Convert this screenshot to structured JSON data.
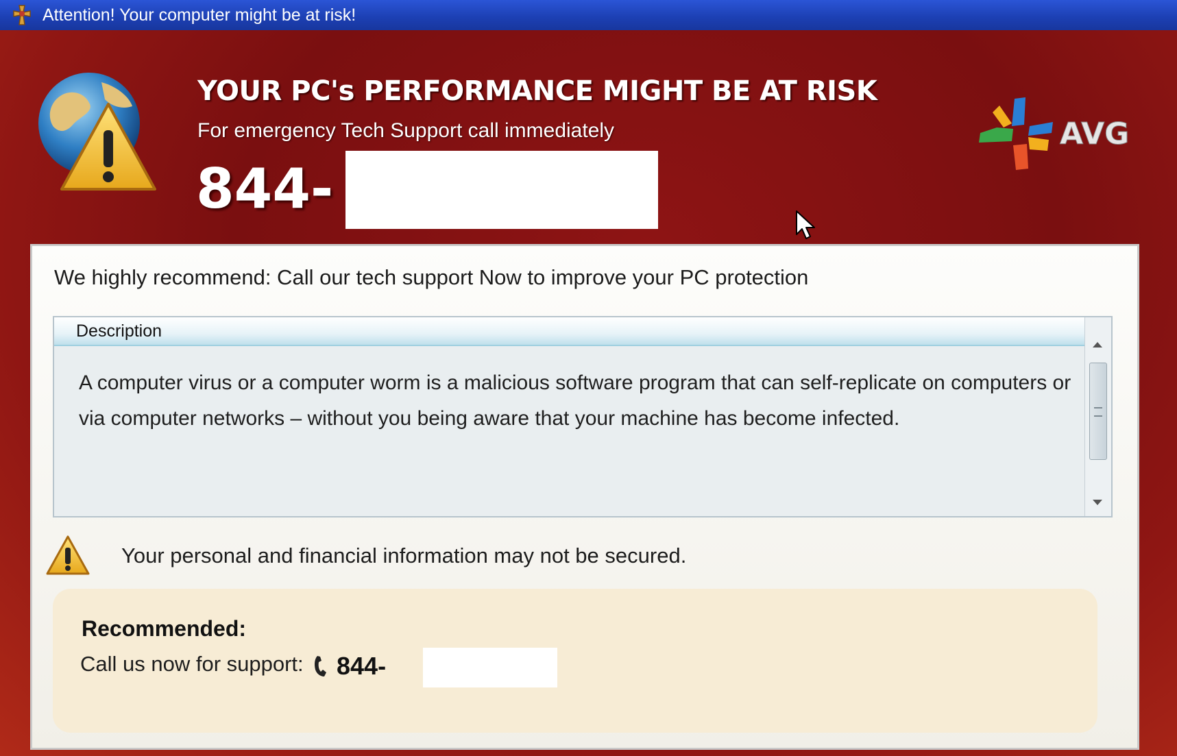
{
  "window": {
    "title": "Attention! Your computer might be at risk!"
  },
  "header": {
    "headline": "YOUR PC's PERFORMANCE MIGHT BE AT RISK",
    "subheadline": "For emergency Tech Support call immediately",
    "phone_prefix": "844-",
    "logo_text": "AVG",
    "icons": [
      "globe-warning-icon",
      "avg-logo-icon",
      "mouse-cursor-icon"
    ]
  },
  "panel": {
    "recommend_line": "We highly recommend: Call our tech support Now to improve your PC protection",
    "description": {
      "header": "Description",
      "text": "A computer virus or a computer worm is a malicious software program that can self-replicate on computers or via computer networks – without you being aware that your machine has become infected."
    },
    "warning": {
      "text": "Your personal and financial information may not be secured.",
      "icon": "warning-triangle-icon"
    },
    "recommended": {
      "title": "Recommended:",
      "line": "Call us now for support:",
      "phone_prefix": "844-",
      "icon": "phone-icon"
    }
  },
  "colors": {
    "titlebar": "#1f3fb0",
    "background_red": "#8e1414",
    "panel": "#f8f7f3",
    "recommended_box": "#f7ecd5",
    "text_white": "#ffffff"
  }
}
